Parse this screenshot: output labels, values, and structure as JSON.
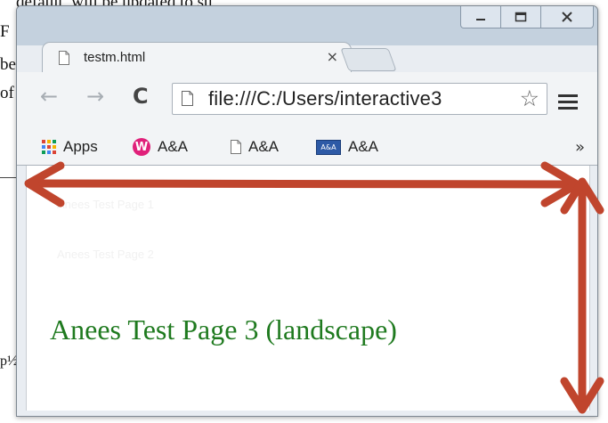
{
  "background_doc": {
    "lines": [
      "default, will be updated to su",
      "F",
      "be",
      "of"
    ],
    "fragment_left": "p½"
  },
  "window": {
    "controls": {
      "minimize_icon": "minimize-icon",
      "restore_icon": "restore-icon",
      "close_icon": "close-icon"
    },
    "tab": {
      "title": "testm.html",
      "close": "×"
    },
    "toolbar": {
      "back_icon": "←",
      "forward_icon": "→",
      "reload_icon": "C",
      "url": "file:///C:/Users/interactive3",
      "star_icon": "☆"
    },
    "bookmarks": {
      "items": [
        {
          "label": "Apps",
          "icon": "apps-grid-icon"
        },
        {
          "label": "A&A",
          "icon": "w-logo-icon"
        },
        {
          "label": "A&A",
          "icon": "page-icon"
        },
        {
          "label": "A&A",
          "icon": "aa-logo-icon",
          "icon_text": "A&A"
        }
      ],
      "overflow": "»"
    }
  },
  "page": {
    "heading": "Anees Test Page 3 (landscape)",
    "faint_lines": [
      "Anees Test Page 1",
      "Anees Test Page 2"
    ]
  },
  "colors": {
    "heading": "#1f7a1f",
    "arrow": "#c0452d",
    "accent_w_icon": "#e0207a",
    "aa_icon": "#2d5aa6"
  }
}
